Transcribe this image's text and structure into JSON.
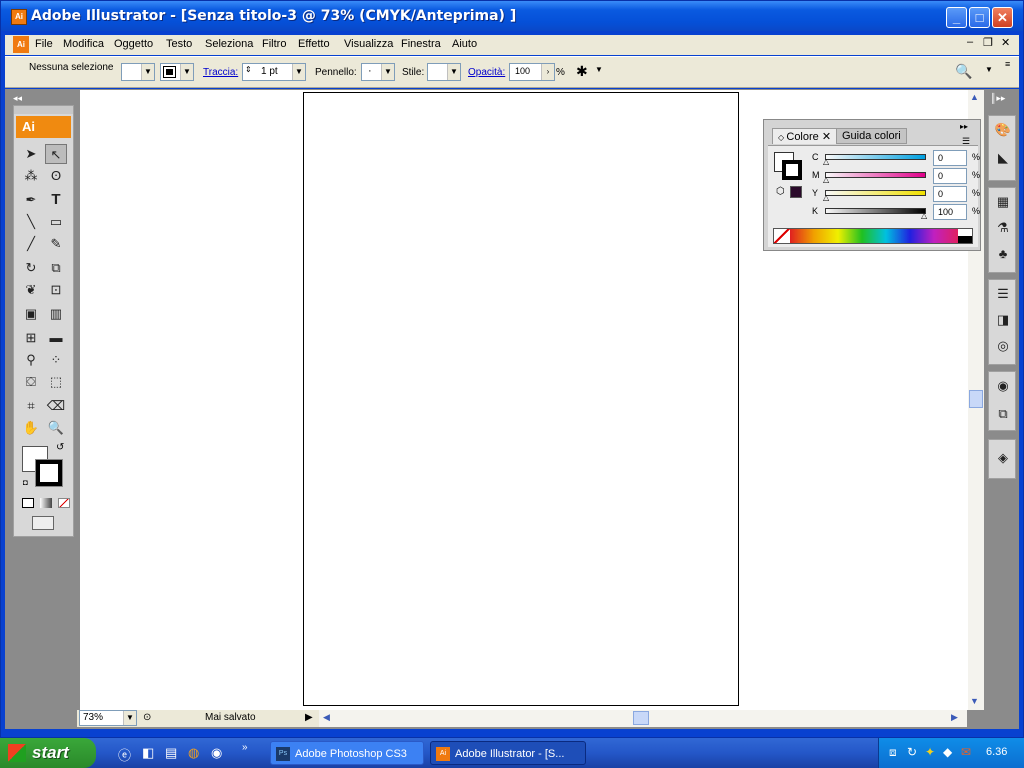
{
  "window": {
    "title": "Adobe Illustrator - [Senza titolo-3 @ 73% (CMYK/Anteprima) ]",
    "app_icon": "Ai"
  },
  "menu": [
    "File",
    "Modifica",
    "Oggetto",
    "Testo",
    "Seleziona",
    "Filtro",
    "Effetto",
    "Visualizza",
    "Finestra",
    "Aiuto"
  ],
  "control": {
    "selection": "Nessuna selezione",
    "traccia_label": "Traccia:",
    "stroke_weight": "1 pt",
    "pennello_label": "Pennello:",
    "pennello_value": "·",
    "stile_label": "Stile:",
    "opacita_label": "Opacità:",
    "opacity_value": "100",
    "pct": "%"
  },
  "toolbox": {
    "logo": "Ai"
  },
  "color_panel": {
    "tab_active": "Colore",
    "tab_other": "Guida colori",
    "sliders": [
      {
        "label": "C",
        "value": "0",
        "pct": "%",
        "color": "#00a0e0"
      },
      {
        "label": "M",
        "value": "0",
        "pct": "%",
        "color": "#e0008a"
      },
      {
        "label": "Y",
        "value": "0",
        "pct": "%",
        "color": "#f0e000"
      },
      {
        "label": "K",
        "value": "100",
        "pct": "%",
        "color": "#000000"
      }
    ]
  },
  "status": {
    "zoom": "73%",
    "save_state": "Mai salvato"
  },
  "taskbar": {
    "start": "start",
    "buttons": [
      {
        "label": "Adobe Photoshop CS3",
        "icon": "Ps"
      },
      {
        "label": "Adobe Illustrator - [S...",
        "icon": "Ai"
      }
    ],
    "clock": "6.36"
  }
}
